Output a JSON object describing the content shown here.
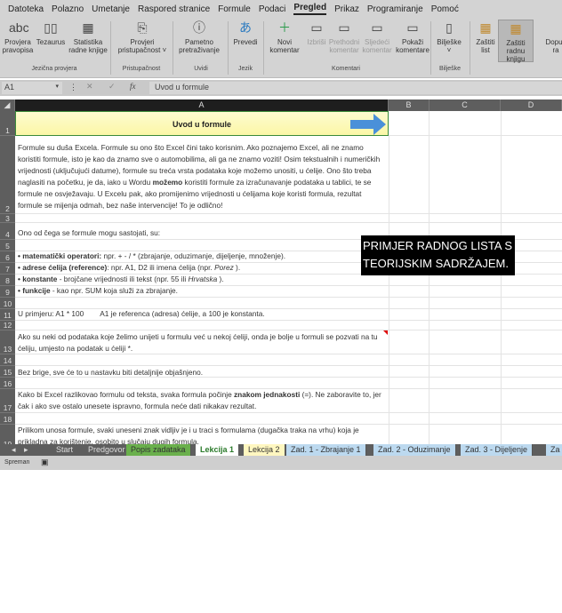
{
  "menu_tabs": [
    "Datoteka",
    "Polazno",
    "Umetanje",
    "Raspored stranice",
    "Formule",
    "Podaci",
    "Pregled",
    "Prikaz",
    "Programiranje",
    "Pomoć"
  ],
  "active_tab": "Pregled",
  "ribbon": {
    "buttons": [
      {
        "l1": "Provjera",
        "l2": "pravopisa",
        "icon": "abc"
      },
      {
        "l1": "Tezaurus",
        "l2": "",
        "icon": "▯▯"
      },
      {
        "l1": "Statistika",
        "l2": "radne knjige",
        "icon": "▦"
      },
      {
        "l1": "Provjeri",
        "l2": "pristupačnost ˅",
        "icon": "⎘"
      },
      {
        "l1": "Pametno",
        "l2": "pretraživanje",
        "icon": "ⓘ"
      },
      {
        "l1": "Prevedi",
        "l2": "",
        "icon": "あ"
      },
      {
        "l1": "Novi",
        "l2": "komentar",
        "icon": "＋"
      },
      {
        "l1": "Izbriši",
        "l2": "",
        "icon": "▭"
      },
      {
        "l1": "Prethodni",
        "l2": "komentar",
        "icon": "▭"
      },
      {
        "l1": "Sljedeći",
        "l2": "komentar",
        "icon": "▭"
      },
      {
        "l1": "Pokaži",
        "l2": "komentare",
        "icon": "▭"
      },
      {
        "l1": "Bilješke",
        "l2": "˅",
        "icon": "▯"
      },
      {
        "l1": "Zaštiti",
        "l2": "list",
        "icon": "▦"
      },
      {
        "l1": "Zaštiti",
        "l2": "radnu knjigu",
        "icon": "▦"
      },
      {
        "l1": "Dopus",
        "l2": "ra",
        "icon": ""
      }
    ],
    "groups": [
      "Jezična provjera",
      "Pristupačnost",
      "Uvidi",
      "Jezik",
      "Komentari",
      "Bilješke"
    ]
  },
  "formula_bar": {
    "name_box": "A1",
    "fx": "fx",
    "value": "Uvod u formule"
  },
  "columns": [
    "A",
    "B",
    "C",
    "D"
  ],
  "rows": [
    "1",
    "2",
    "3",
    "4",
    "5",
    "6",
    "7",
    "8",
    "9",
    "10",
    "11",
    "12",
    "13",
    "14",
    "15",
    "16",
    "17",
    "18",
    "19"
  ],
  "cells": {
    "a1": "Uvod u formule",
    "a2_pre": "Formule su duša Excela. Formule su ono što Excel čini tako korisnim. Ako poznajemo Excel, ali ne znamo koristiti formule, isto je kao da znamo sve o automobilima, ali ga ne znamo voziti! Osim tekstualnih i numeričkih vrijednosti (uključujući datume), formule su treća vrsta podataka koje možemo unositi, u ćelije. Ono što treba naglasiti na početku, je da, iako u Wordu ",
    "a2_bold": "možemo",
    "a2_post": " koristiti formule za izračunavanje podataka u tablici, te se formule ne osvježavaju. U Excelu pak, ako promijenimo vrijednosti u ćelijama koje koristi formula, rezultat formule se mijenja odmah, bez naše intervencije! To je odlično!",
    "a4": "Ono od čega se formule mogu sastojati, su:",
    "a6_b": "• matematički operatori:",
    "a6": " npr. + - / * (zbrajanje, oduzimanje, dijeljenje, množenje).",
    "a7_b": "• adrese ćelija (reference)",
    "a7": ": npr. A1, D2 ili imena ćelija (npr. ",
    "a7_i": "Porez",
    "a7_e": " ).",
    "a8_b": "• konstante",
    "a8": " - brojčane vrijednosti ili tekst (npr. 55 ili ",
    "a8_i": "Hrvatska",
    "a8_e": " ).",
    "a9_b": "• funkcije",
    "a9": " - kao npr. SUM koja služi za zbrajanje.",
    "a11": "U primjeru: A1 * 100        A1 je referenca (adresa) ćelije, a 100 je konstanta.",
    "a13": "Ako su neki od podataka koje želimo unijeti u formulu već u nekoj ćeliji, onda je bolje u formuli se pozvati na tu ćeliju, umjesto na podatak u ćeliji *.",
    "a15": "Bez brige, sve će to u nastavku biti detaljnije objašnjeno.",
    "a17_pre": "Kako bi Excel razlikovao formulu od teksta, svaka formula počinje ",
    "a17_b": "znakom jednakosti",
    "a17_post": " (=). Ne zaboravite to, jer čak i ako sve ostalo unesete ispravno, formula neće dati nikakav rezultat.",
    "a19": "Prilikom unosa formule, svaki uneseni znak vidljiv je i u traci s formulama (dugačka traka na vrhu) koja je prikladna za korištenje, osobito u slučaju dugih formula."
  },
  "callout": "PRIMJER RADNOG LISTA S TEORIJSKIM SADRŽAJEM.",
  "sheet_tabs": [
    {
      "label": "Start",
      "color": ""
    },
    {
      "label": "Predgovor",
      "color": ""
    },
    {
      "label": "Popis zadataka",
      "color": "#6ab04c"
    },
    {
      "label": "Lekcija 1",
      "color": "#ffffff"
    },
    {
      "label": "Lekcija 2",
      "color": "#fff7c0"
    },
    {
      "label": "Zad. 1 - Zbrajanje 1",
      "color": "#bcd9ef"
    },
    {
      "label": "Zad. 2 - Oduzimanje",
      "color": "#bcd9ef"
    },
    {
      "label": "Zad. 3 - Dijeljenje",
      "color": "#bcd9ef"
    },
    {
      "label": "Za",
      "color": "#bcd9ef"
    }
  ],
  "status": "Spreman"
}
